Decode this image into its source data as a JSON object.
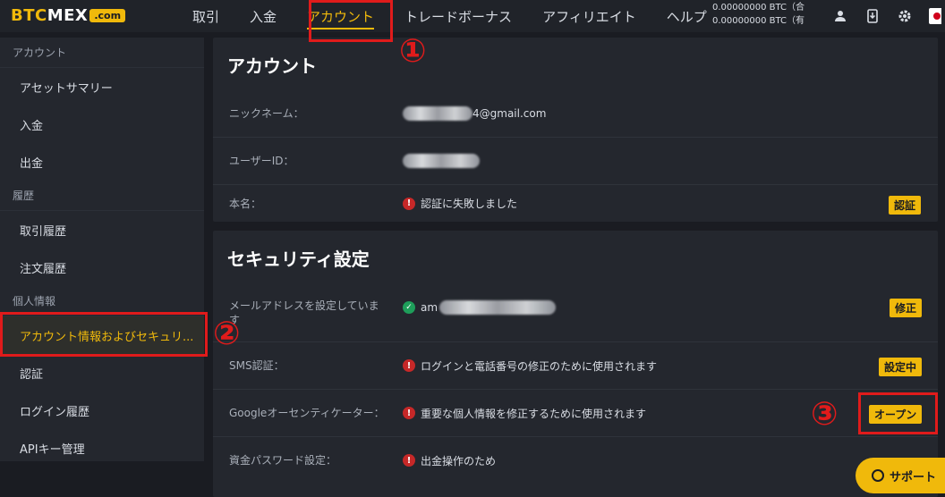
{
  "header": {
    "logo_main": "BTC",
    "logo_mex": "MEX",
    "logo_com": ".com",
    "nav": [
      "取引",
      "入金",
      "アカウント",
      "トレードボーナス",
      "アフィリエイト",
      "ヘルプ"
    ],
    "balance_line1": "0.00000000 BTC（合",
    "balance_line2": "0.00000000 BTC（有"
  },
  "sidebar": {
    "group_account": "アカウント",
    "item_asset_summary": "アセットサマリー",
    "item_deposit": "入金",
    "item_withdraw": "出金",
    "group_history": "履歴",
    "item_trade_history": "取引履歴",
    "item_order_history": "注文履歴",
    "group_personal": "個人情報",
    "item_account_security": "アカウント情報およびセキュリ...",
    "item_verification": "認証",
    "item_login_history": "ログイン履歴",
    "item_api_keys": "APIキー管理"
  },
  "account_panel": {
    "title": "アカウント",
    "nickname_label": "ニックネーム：",
    "nickname_value": "4@gmail.com",
    "userid_label": "ユーザーID：",
    "realname_label": "本名：",
    "realname_value": "認証に失敗しました",
    "verify_button": "認証"
  },
  "security_panel": {
    "title": "セキュリティ設定",
    "email_label": "メールアドレスを設定していま す",
    "email_value": "am",
    "email_button": "修正",
    "sms_label": "SMS認証：",
    "sms_value": "ログインと電話番号の修正のために使用されます",
    "sms_button": "設定中",
    "google_label": "Googleオーセンティケーター：",
    "google_value": "重要な個人情報を修正するために使用されます",
    "google_button": "オープン",
    "fund_pw_label": "資金パスワード設定：",
    "fund_pw_value": "出金操作のため"
  },
  "annotations": {
    "step1": "①",
    "step2": "②",
    "step3": "③"
  },
  "support_label": "サポート",
  "colors": {
    "accent": "#f0b90b",
    "annotation": "#e01b1b",
    "error": "#c62828",
    "success": "#1e9e5a"
  }
}
